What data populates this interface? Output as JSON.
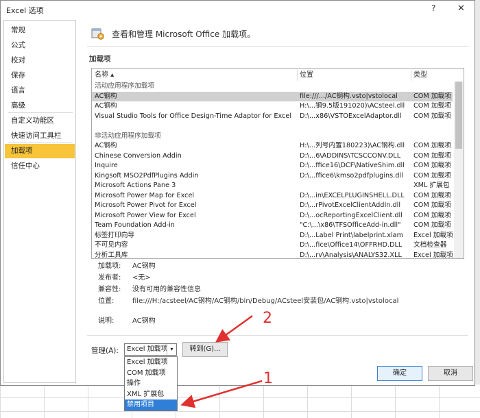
{
  "window": {
    "title": "Excel 选项",
    "help_glyph": "?",
    "close_glyph": "✕"
  },
  "sidebar": {
    "items": [
      {
        "label": "常规"
      },
      {
        "label": "公式"
      },
      {
        "label": "校对"
      },
      {
        "label": "保存"
      },
      {
        "label": "语言"
      },
      {
        "label": "高级"
      },
      {
        "label": "自定义功能区"
      },
      {
        "label": "快速访问工具栏"
      },
      {
        "label": "加载项",
        "active": true
      },
      {
        "label": "信任中心"
      }
    ]
  },
  "header": {
    "text": "查看和管理 Microsoft Office 加载项。",
    "icon": "gear-addin-icon"
  },
  "addins": {
    "section_title": "加载项",
    "columns": {
      "name": "名称 ▴",
      "location": "位置",
      "type": "类型"
    },
    "rows": [
      {
        "group": "活动应用程序加载项"
      },
      {
        "name": "AC钢构",
        "location": "file:///.../AC钢构.vsto|vstolocal",
        "type": "COM 加载项",
        "selected": true
      },
      {
        "name": "AC钢构",
        "location": "H:\\...钢9.5版191020)\\ACsteel.dll",
        "type": "COM 加载项"
      },
      {
        "name": "Visual Studio Tools for Office Design-Time Adaptor for Excel",
        "location": "D:\\...x86\\VSTOExcelAdaptor.dll",
        "type": "COM 加载项"
      },
      {
        "group": ""
      },
      {
        "group": "非活动应用程序加载项"
      },
      {
        "name": "AC钢构",
        "location": "H:\\...列号内置180223)\\AC钢构.dll",
        "type": "COM 加载项"
      },
      {
        "name": "Chinese Conversion Addin",
        "location": "D:\\...6\\ADDINS\\TCSCCONV.DLL",
        "type": "COM 加载项"
      },
      {
        "name": "Inquire",
        "location": "D:\\...ffice16\\DCF\\NativeShim.dll",
        "type": "COM 加载项"
      },
      {
        "name": "Kingsoft MSO2PdfPlugins Addin",
        "location": "D:\\...ffice6\\kmso2pdfplugins.dll",
        "type": "COM 加载项"
      },
      {
        "name": "Microsoft Actions Pane 3",
        "location": "",
        "type": "XML 扩展包"
      },
      {
        "name": "Microsoft Power Map for Excel",
        "location": "D:\\...in\\EXCELPLUGINSHELL.DLL",
        "type": "COM 加载项"
      },
      {
        "name": "Microsoft Power Pivot for Excel",
        "location": "D:\\...rPivotExcelClientAddIn.dll",
        "type": "COM 加载项"
      },
      {
        "name": "Microsoft Power View for Excel",
        "location": "D:\\...ocReportingExcelClient.dll",
        "type": "COM 加载项"
      },
      {
        "name": "Team Foundation Add-in",
        "location": "\"C:\\...\\x86\\TFSOfficeAdd-in.dll\"",
        "type": "COM 加载项"
      },
      {
        "name": "标签打印向导",
        "location": "D:\\...Label Print\\labelprint.xlam",
        "type": "Excel 加载项"
      },
      {
        "name": "不可见内容",
        "location": "D:\\...fice\\Office14\\OFFRHD.DLL",
        "type": "文档检查器"
      },
      {
        "name": "分析工具库",
        "location": "D:\\...rv\\Analysis\\ANALYS32.XLL",
        "type": "Excel 加载项"
      }
    ]
  },
  "details": [
    {
      "label": "加载项:",
      "value": "AC钢构"
    },
    {
      "label": "发布者:",
      "value": "<无>"
    },
    {
      "label": "兼容性:",
      "value": "没有可用的兼容性信息"
    },
    {
      "label": "位置:",
      "value": "file:///H:/acsteel/AC钢构/AC钢构/bin/Debug/ACsteel安装包/AC钢构.vsto|vstolocal"
    },
    {
      "label": "说明:",
      "value": "AC钢构"
    }
  ],
  "manage": {
    "label": "管理(A):",
    "selected": "Excel 加载项",
    "goto_label": "转到(G)...",
    "options": [
      "Excel 加载项",
      "COM 加载项",
      "操作",
      "XML 扩展包",
      "禁用项目"
    ],
    "highlighted_index": 4
  },
  "buttons": {
    "ok": "确定",
    "cancel": "取消"
  },
  "annotations": {
    "marker_1": "1",
    "marker_2": "2",
    "color": "#e03030"
  }
}
